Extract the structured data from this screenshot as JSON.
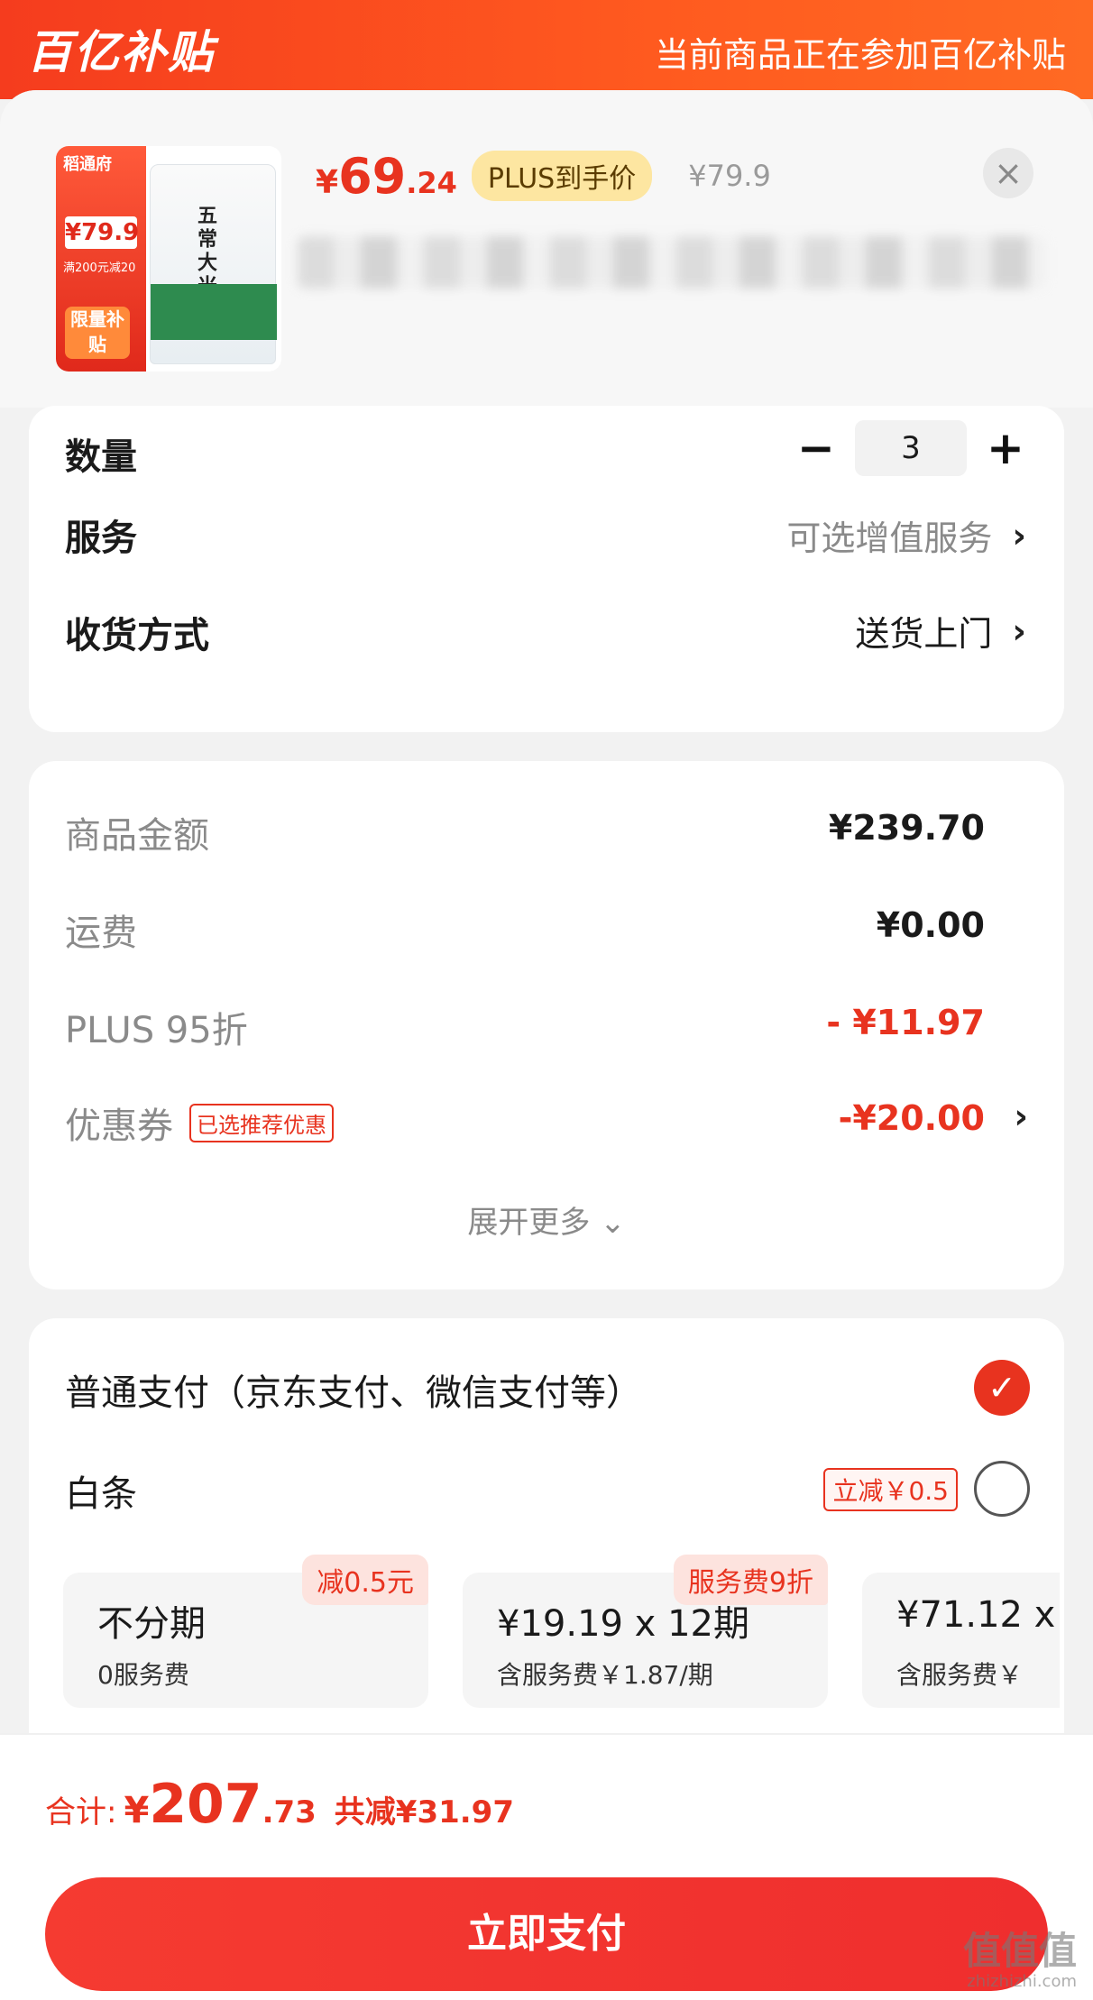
{
  "header": {
    "logo": "百亿补贴",
    "tagline": "当前商品正在参加百亿补贴"
  },
  "product": {
    "thumb": {
      "brand": "稻通府",
      "badge_price": "¥79.9",
      "badge_deal": "满200元减20",
      "badge_limit": "限量补贴",
      "bag_label": "五常大米"
    },
    "price_yen": "¥",
    "price_int": "69",
    "price_dec": ".24",
    "plus_label": "PLUS到手价",
    "orig_price": "¥79.9",
    "close_icon": "×"
  },
  "options": {
    "quantity_label": "数量",
    "quantity_minus": "−",
    "quantity_value": "3",
    "quantity_plus": "+",
    "service_label": "服务",
    "service_value": "可选增值服务",
    "delivery_label": "收货方式",
    "delivery_value": "送货上门",
    "chevron": "›"
  },
  "amounts": {
    "goods_label": "商品金额",
    "goods_value": "¥239.70",
    "shipping_label": "运费",
    "shipping_value": "¥0.00",
    "plus_label": "PLUS 95折",
    "plus_value": "- ¥11.97",
    "coupon_label": "优惠券",
    "coupon_tag": "已选推荐优惠",
    "coupon_value": "-¥20.00",
    "expand_label": "展开更多",
    "expand_icon": "⌄"
  },
  "payment": {
    "normal_label": "普通支付（京东支付、微信支付等）",
    "normal_check": "✓",
    "baitiao_label": "白条",
    "baitiao_promo": "立减￥0.5",
    "plans": [
      {
        "title": "不分期",
        "sub": "0服务费",
        "badge": "减0.5元"
      },
      {
        "title": "¥19.19 x 12期",
        "sub": "含服务费￥1.87/期",
        "badge": "服务费9折"
      },
      {
        "title": "¥71.12 x",
        "sub": "含服务费￥",
        "badge": ""
      }
    ]
  },
  "footer": {
    "total_label": "合计:",
    "total_yen": "¥",
    "total_int": "207",
    "total_dec": ".73",
    "total_save": "共减¥31.97",
    "pay_button": "立即支付",
    "watermark": "值值值",
    "watermark_sub": "zhizhizhi.com"
  },
  "colors": {
    "brand_red": "#e8331f",
    "header_orange": "#ff5a1f",
    "plus_gold": "#fde6a1"
  }
}
